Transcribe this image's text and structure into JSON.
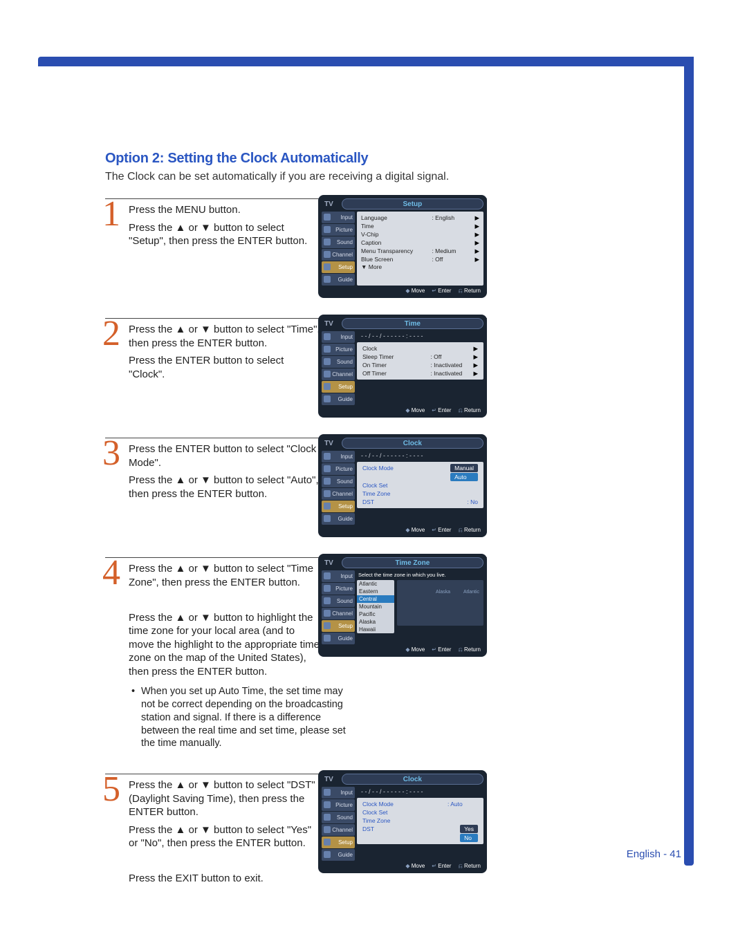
{
  "page_label": "English - 41",
  "heading": "Option 2: Setting the Clock Automatically",
  "intro": "The Clock can be set automatically if you are receiving a digital signal.",
  "menu_tabs": [
    "Input",
    "Picture",
    "Sound",
    "Channel",
    "Setup",
    "Guide"
  ],
  "osd_footer": {
    "move": "Move",
    "enter": "Enter",
    "return": "Return"
  },
  "steps": [
    {
      "num": "1",
      "text_lines": [
        "Press the MENU button.",
        "Press the ▲ or ▼ button to select \"Setup\", then press the ENTER button."
      ],
      "osd": {
        "title": "Setup",
        "highlight_tab": "Setup",
        "rows": [
          {
            "label": "Language",
            "value": ": English",
            "arrow": "▶"
          },
          {
            "label": "Time",
            "value": "",
            "arrow": "▶"
          },
          {
            "label": "V-Chip",
            "value": "",
            "arrow": "▶"
          },
          {
            "label": "Caption",
            "value": "",
            "arrow": "▶"
          },
          {
            "label": "Menu Transparency",
            "value": ": Medium",
            "arrow": "▶"
          },
          {
            "label": "Blue Screen",
            "value": ": Off",
            "arrow": "▶"
          }
        ],
        "more": "▼ More"
      }
    },
    {
      "num": "2",
      "text_lines": [
        "Press the ▲ or ▼ button to select \"Time\", then press the ENTER button.",
        "Press the ENTER button to select \"Clock\"."
      ],
      "osd": {
        "title": "Time",
        "highlight_tab": "Setup",
        "darkline": "- - / - - / - - - -     - -  :  - -   - -",
        "rows": [
          {
            "label": "Clock",
            "value": "",
            "arrow": "▶"
          },
          {
            "label": "Sleep Timer",
            "value": ": Off",
            "arrow": "▶"
          },
          {
            "label": "On Timer",
            "value": ": Inactivated",
            "arrow": "▶"
          },
          {
            "label": "Off Timer",
            "value": ": Inactivated",
            "arrow": "▶"
          }
        ]
      }
    },
    {
      "num": "3",
      "text_lines": [
        "Press the ENTER button to select \"Clock Mode\".",
        "Press the ▲ or ▼ button to select \"Auto\", then press the ENTER button."
      ],
      "osd": {
        "title": "Clock",
        "highlight_tab": "Setup",
        "darkline": "- - / - - / - - - -     - -  :  - -   - -",
        "bluerows": [
          {
            "label": "Clock Mode",
            "pill1": "Manual",
            "pill2": "Auto",
            "sel": 2
          },
          {
            "label": "Clock Set",
            "value": ""
          },
          {
            "label": "Time Zone",
            "value": ""
          },
          {
            "label": "DST",
            "value": ": No"
          }
        ]
      }
    },
    {
      "num": "4",
      "text_lines": [
        "Press the ▲ or ▼ button to select \"Time Zone\", then press the ENTER button.",
        "",
        "Press the ▲ or ▼ button to highlight the time zone for your local area (and to move the highlight to the appropriate time zone on the map of the United States), then press the ENTER button."
      ],
      "bullet": "When you set up Auto Time, the set time may not be correct depending on the broadcasting station and signal. If there is a difference between the real time and set time, please set the time manually.",
      "osd": {
        "title": "Time Zone",
        "highlight_tab": "Setup",
        "prompt": "Select the time zone in which you live.",
        "tz_options": [
          "Atlantic",
          "Eastern",
          "Central",
          "Mountain",
          "Pacific",
          "Alaska",
          "Hawaii"
        ],
        "tz_selected": "Central",
        "map_labels": {
          "l1": "Alaska",
          "l2": "Atlantic"
        }
      }
    },
    {
      "num": "5",
      "text_lines": [
        "Press the ▲ or ▼ button to select \"DST\"(Daylight Saving Time), then press the ENTER button.",
        "Press the ▲ or ▼ button to select \"Yes\" or \"No\", then press the ENTER button.",
        "",
        "Press the EXIT button to exit."
      ],
      "osd": {
        "title": "Clock",
        "highlight_tab": "Setup",
        "darkline": "- - / - - / - - - -     - -  :  - -   - -",
        "bluerows5": [
          {
            "label": "Clock Mode",
            "value": ": Auto"
          },
          {
            "label": "Clock Set",
            "value": ""
          },
          {
            "label": "Time Zone",
            "value": ""
          },
          {
            "label": "DST",
            "pill1": "Yes",
            "pill2": "No",
            "sel": 2
          }
        ]
      }
    }
  ]
}
